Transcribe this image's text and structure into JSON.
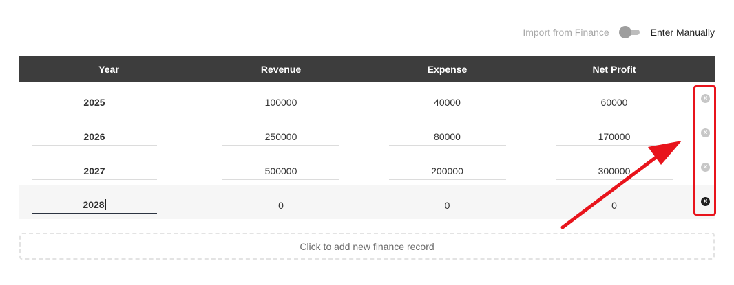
{
  "toggle": {
    "left_label": "Import from Finance",
    "right_label": "Enter Manually",
    "state": "manual"
  },
  "table": {
    "headers": {
      "year": "Year",
      "revenue": "Revenue",
      "expense": "Expense",
      "net_profit": "Net Profit"
    },
    "rows": [
      {
        "year": "2025",
        "revenue": "100000",
        "expense": "40000",
        "net_profit": "60000"
      },
      {
        "year": "2026",
        "revenue": "250000",
        "expense": "80000",
        "net_profit": "170000"
      },
      {
        "year": "2027",
        "revenue": "500000",
        "expense": "200000",
        "net_profit": "300000"
      },
      {
        "year": "2028",
        "revenue": "0",
        "expense": "0",
        "net_profit": "0"
      }
    ],
    "remove_glyph": "×"
  },
  "add_record": {
    "label": "Click to add new finance record"
  },
  "annotation": {
    "color": "#e8141c"
  }
}
